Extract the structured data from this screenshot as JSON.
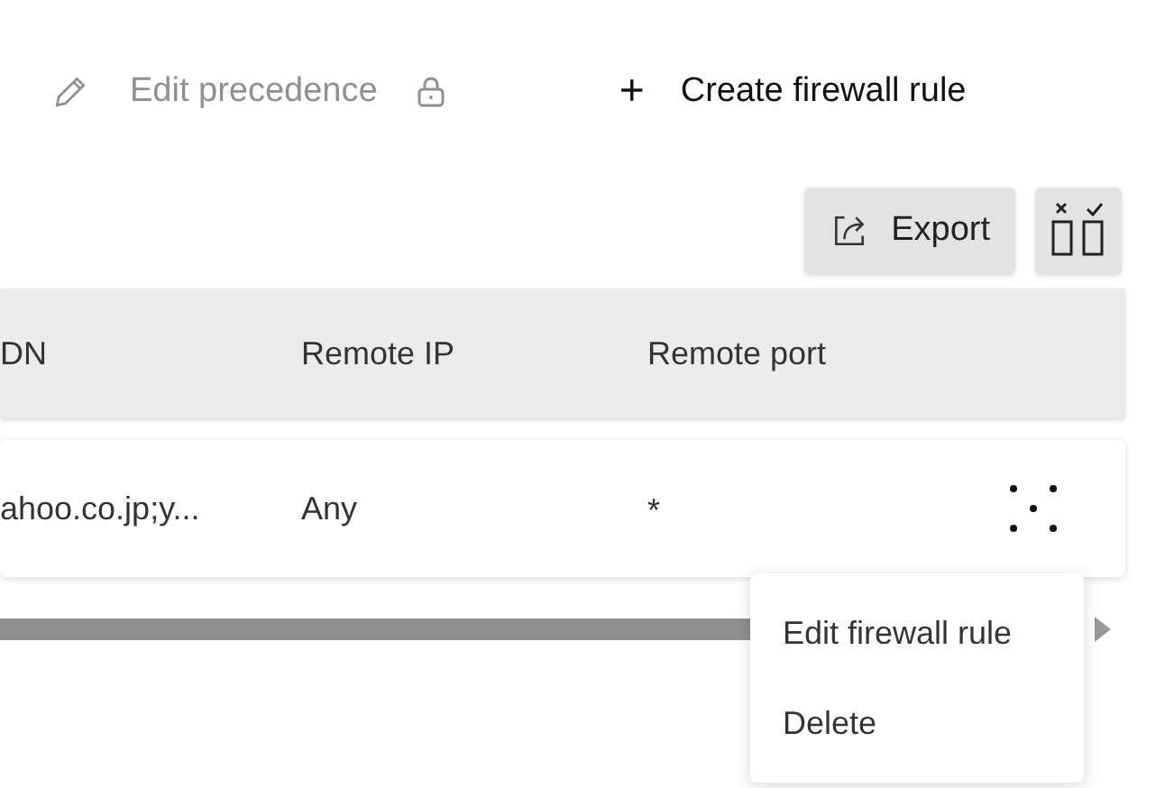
{
  "toolbar": {
    "edit_precedence": {
      "label": "Edit precedence",
      "disabled": true
    },
    "create": {
      "label": "Create firewall rule",
      "icon": "+"
    }
  },
  "actions": {
    "export": "Export"
  },
  "table": {
    "columns": [
      "DN",
      "Remote IP",
      "Remote port"
    ],
    "rows": [
      {
        "cells": [
          "ahoo.co.jp;y...",
          "Any",
          "*"
        ],
        "menu_open": true
      }
    ]
  },
  "row_menu": [
    "Edit firewall rule",
    "Delete"
  ]
}
